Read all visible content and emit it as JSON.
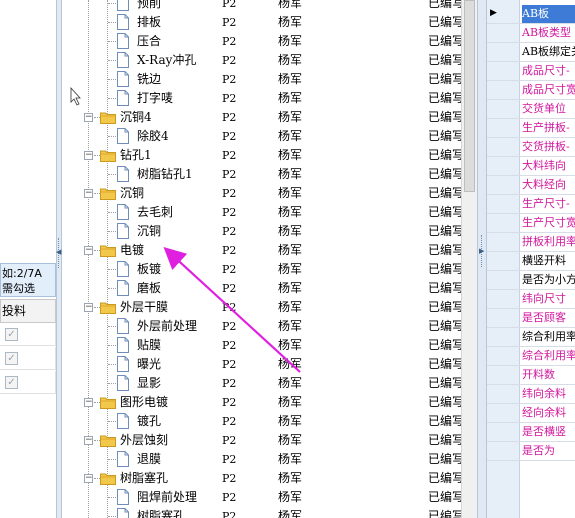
{
  "left_panel": {
    "hint_line1": "如:2/7A",
    "hint_line2": "需勾选",
    "column_header": "投料",
    "checkboxes": [
      "✓",
      "✓",
      "✓"
    ]
  },
  "tree": {
    "rows": [
      {
        "name": "预削",
        "type": "file",
        "level": 2,
        "ver": "P2",
        "user": "杨军",
        "status": "已编写"
      },
      {
        "name": "排板",
        "type": "file",
        "level": 2,
        "ver": "P2",
        "user": "杨军",
        "status": "已编写"
      },
      {
        "name": "压合",
        "type": "file",
        "level": 2,
        "ver": "P2",
        "user": "杨军",
        "status": "已编写"
      },
      {
        "name": "X-Ray冲孔",
        "type": "file",
        "level": 2,
        "ver": "P2",
        "user": "杨军",
        "status": "已编写"
      },
      {
        "name": "铣边",
        "type": "file",
        "level": 2,
        "ver": "P2",
        "user": "杨军",
        "status": "已编写"
      },
      {
        "name": "打字唛",
        "type": "file",
        "level": 2,
        "ver": "P2",
        "user": "杨军",
        "status": "已编写"
      },
      {
        "name": "沉铜4",
        "type": "folder",
        "level": 1,
        "ver": "P2",
        "user": "杨军",
        "status": "已编写"
      },
      {
        "name": "除胶4",
        "type": "file",
        "level": 2,
        "ver": "P2",
        "user": "杨军",
        "status": "已编写"
      },
      {
        "name": "钻孔1",
        "type": "folder",
        "level": 1,
        "ver": "P2",
        "user": "杨军",
        "status": "已编写"
      },
      {
        "name": "树脂钻孔1",
        "type": "file",
        "level": 2,
        "ver": "P2",
        "user": "杨军",
        "status": "已编写"
      },
      {
        "name": "沉铜",
        "type": "folder",
        "level": 1,
        "ver": "P2",
        "user": "杨军",
        "status": "已编写"
      },
      {
        "name": "去毛刺",
        "type": "file",
        "level": 2,
        "ver": "P2",
        "user": "杨军",
        "status": "已编写"
      },
      {
        "name": "沉铜",
        "type": "file",
        "level": 2,
        "ver": "P2",
        "user": "杨军",
        "status": "已编写"
      },
      {
        "name": "电镀",
        "type": "folder",
        "level": 1,
        "ver": "P2",
        "user": "杨军",
        "status": "已编写"
      },
      {
        "name": "板镀",
        "type": "file",
        "level": 2,
        "ver": "P2",
        "user": "杨军",
        "status": "已编写"
      },
      {
        "name": "磨板",
        "type": "file",
        "level": 2,
        "ver": "P2",
        "user": "杨军",
        "status": "已编写"
      },
      {
        "name": "外层干膜",
        "type": "folder",
        "level": 1,
        "ver": "P2",
        "user": "杨军",
        "status": "已编写"
      },
      {
        "name": "外层前处理",
        "type": "file",
        "level": 2,
        "ver": "P2",
        "user": "杨军",
        "status": "已编写"
      },
      {
        "name": "贴膜",
        "type": "file",
        "level": 2,
        "ver": "P2",
        "user": "杨军",
        "status": "已编写"
      },
      {
        "name": "曝光",
        "type": "file",
        "level": 2,
        "ver": "P2",
        "user": "杨军",
        "status": "已编写"
      },
      {
        "name": "显影",
        "type": "file",
        "level": 2,
        "ver": "P2",
        "user": "杨军",
        "status": "已编写"
      },
      {
        "name": "图形电镀",
        "type": "folder",
        "level": 1,
        "ver": "P2",
        "user": "杨军",
        "status": "已编写"
      },
      {
        "name": "镀孔",
        "type": "file",
        "level": 2,
        "ver": "P2",
        "user": "杨军",
        "status": "已编写"
      },
      {
        "name": "外层蚀刻",
        "type": "folder",
        "level": 1,
        "ver": "P2",
        "user": "杨军",
        "status": "已编写"
      },
      {
        "name": "退膜",
        "type": "file",
        "level": 2,
        "ver": "P2",
        "user": "杨军",
        "status": "已编写"
      },
      {
        "name": "树脂塞孔",
        "type": "folder",
        "level": 1,
        "ver": "P2",
        "user": "杨军",
        "status": "已编写"
      },
      {
        "name": "阻焊前处理",
        "type": "file",
        "level": 2,
        "ver": "P2",
        "user": "杨军",
        "status": "已编写"
      },
      {
        "name": "树脂塞孔",
        "type": "file",
        "level": 2,
        "ver": "P2",
        "user": "杨军",
        "status": "已编写"
      }
    ]
  },
  "properties": {
    "rows": [
      {
        "label": "AB板",
        "style": "selected",
        "marker": "▶"
      },
      {
        "label": "AB板类型",
        "style": "magenta",
        "marker": ""
      },
      {
        "label": "AB板绑定关",
        "style": "black",
        "marker": ""
      },
      {
        "label": "成品尺寸-",
        "style": "magenta",
        "marker": ""
      },
      {
        "label": "成品尺寸宽",
        "style": "magenta",
        "marker": ""
      },
      {
        "label": "交货单位",
        "style": "magenta",
        "marker": ""
      },
      {
        "label": "生产拼板-",
        "style": "magenta",
        "marker": ""
      },
      {
        "label": "交货拼板-",
        "style": "magenta",
        "marker": ""
      },
      {
        "label": "大料纬向",
        "style": "magenta",
        "marker": ""
      },
      {
        "label": "大料经向",
        "style": "magenta",
        "marker": ""
      },
      {
        "label": "生产尺寸-",
        "style": "magenta",
        "marker": ""
      },
      {
        "label": "生产尺寸宽",
        "style": "magenta",
        "marker": ""
      },
      {
        "label": "拼板利用率",
        "style": "magenta",
        "marker": ""
      },
      {
        "label": "横竖开料",
        "style": "black",
        "marker": ""
      },
      {
        "label": "是否为小方",
        "style": "black",
        "marker": ""
      },
      {
        "label": "纬向尺寸",
        "style": "magenta",
        "marker": ""
      },
      {
        "label": "是否顾客",
        "style": "magenta",
        "marker": ""
      },
      {
        "label": "综合利用率",
        "style": "black",
        "marker": ""
      },
      {
        "label": "综合利用率",
        "style": "magenta",
        "marker": ""
      },
      {
        "label": "开料数",
        "style": "magenta",
        "marker": ""
      },
      {
        "label": "纬向余料",
        "style": "magenta",
        "marker": ""
      },
      {
        "label": "经向余料",
        "style": "magenta",
        "marker": ""
      },
      {
        "label": "是否横竖",
        "style": "magenta",
        "marker": ""
      },
      {
        "label": "是否为",
        "style": "magenta",
        "marker": ""
      }
    ]
  },
  "colors": {
    "selection": "#3d7bd6",
    "required_label": "#d0179c",
    "annotation_arrow": "#e020e0",
    "folder": "#f2c84b"
  },
  "icons": {
    "folder": "folder-icon",
    "file": "file-icon",
    "expand": "collapse-minus-icon",
    "pointer": "mouse-cursor-icon",
    "row_marker": "current-row-triangle-icon"
  }
}
